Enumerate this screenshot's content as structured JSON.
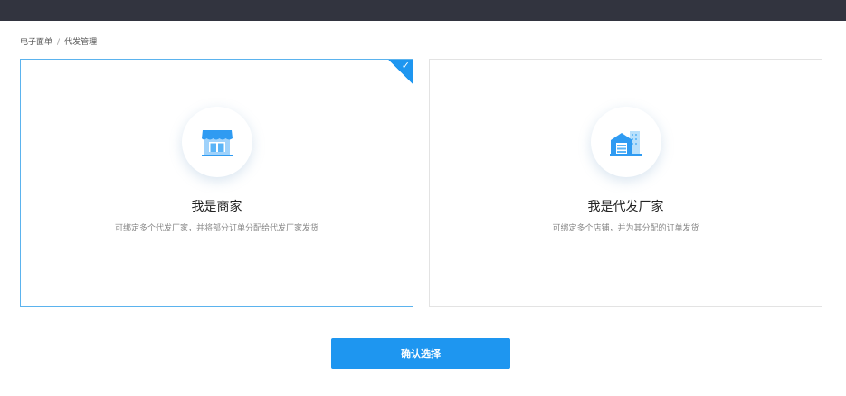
{
  "breadcrumb": {
    "parent": "电子面单",
    "separator": "/",
    "current": "代发管理"
  },
  "options": [
    {
      "title": "我是商家",
      "description": "可绑定多个代发厂家，并将部分订单分配给代发厂家发货",
      "icon": "store-icon",
      "selected": true
    },
    {
      "title": "我是代发厂家",
      "description": "可绑定多个店铺，并为其分配的订单发货",
      "icon": "warehouse-icon",
      "selected": false
    }
  ],
  "confirm_label": "确认选择",
  "selected_check": "✓",
  "colors": {
    "accent": "#1e96f0",
    "selected_border": "#5bb3ee",
    "topbar": "#32343f"
  }
}
